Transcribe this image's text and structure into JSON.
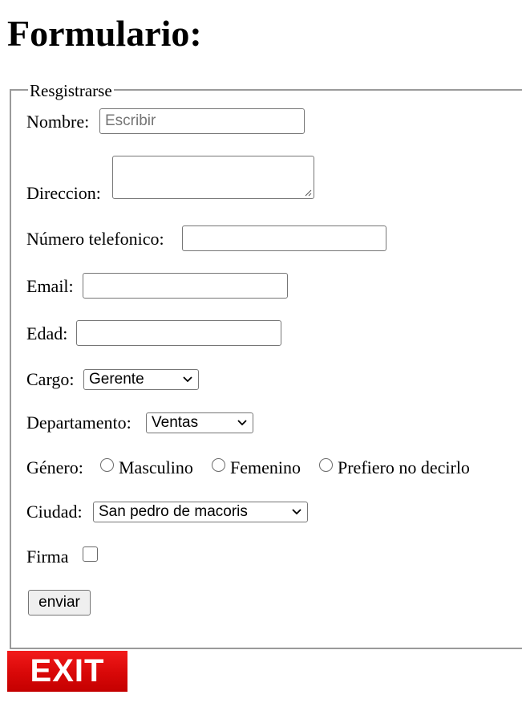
{
  "page": {
    "title": "Formulario:"
  },
  "form": {
    "legend": "Resgistrarse",
    "nombre": {
      "label": "Nombre:",
      "placeholder": "Escribir",
      "value": ""
    },
    "direccion": {
      "label": "Direccion:",
      "value": ""
    },
    "telefono": {
      "label": "Número telefonico:",
      "value": ""
    },
    "email": {
      "label": "Email:",
      "value": ""
    },
    "edad": {
      "label": "Edad:",
      "value": ""
    },
    "cargo": {
      "label": "Cargo:",
      "selected": "Gerente"
    },
    "departamento": {
      "label": "Departamento:",
      "selected": "Ventas"
    },
    "genero": {
      "label": "Género:",
      "options": [
        "Masculino",
        "Femenino",
        "Prefiero no decirlo"
      ],
      "selected": null
    },
    "ciudad": {
      "label": "Ciudad:",
      "selected": "San pedro de macoris"
    },
    "firma": {
      "label": "Firma",
      "checked": false
    },
    "submit_label": "enviar"
  },
  "exit": {
    "label": "EXIT",
    "color": "#e00000"
  }
}
